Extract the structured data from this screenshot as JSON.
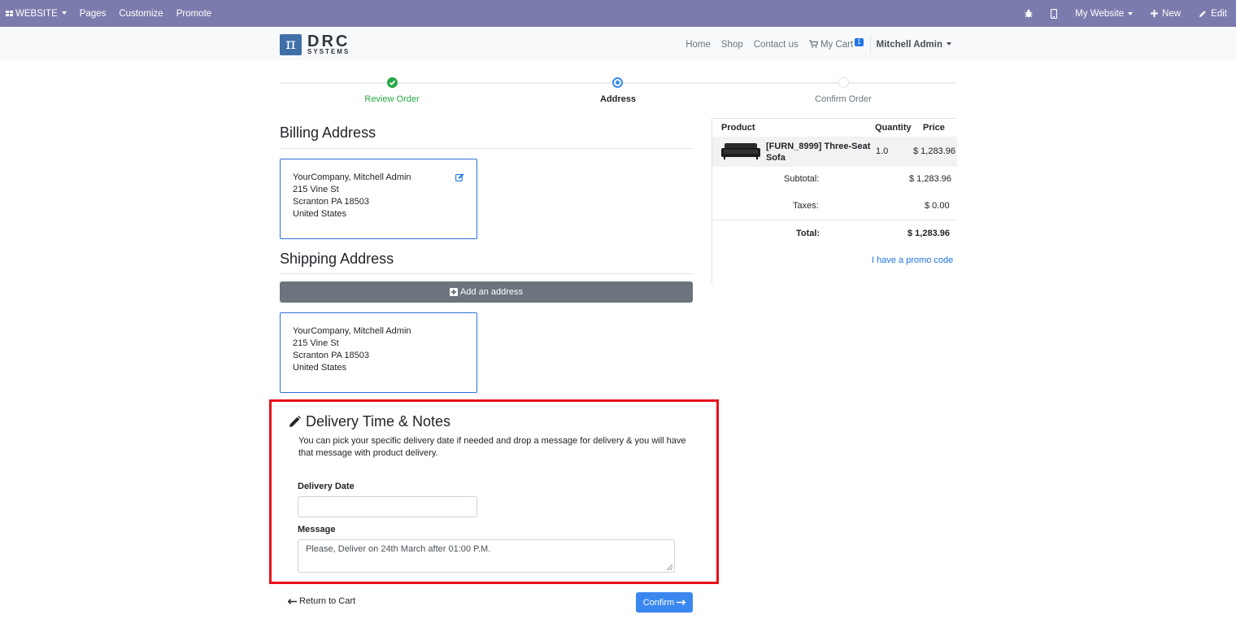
{
  "adminbar": {
    "website_label": "WEBSITE",
    "menu": [
      "Pages",
      "Customize",
      "Promote"
    ],
    "my_website": "My Website",
    "new_label": "New",
    "edit_label": "Edit"
  },
  "brand": {
    "name": "DRC",
    "sub": "SYSTEMS",
    "symbol": "π"
  },
  "nav": {
    "home": "Home",
    "shop": "Shop",
    "contact": "Contact us",
    "cart": "My Cart",
    "cart_count": "1",
    "user": "Mitchell Admin"
  },
  "wizard": {
    "steps": [
      "Review Order",
      "Address",
      "Confirm Order"
    ]
  },
  "billing": {
    "title": "Billing Address",
    "lines": [
      "YourCompany, Mitchell Admin",
      "215 Vine St",
      "Scranton PA 18503",
      "United States"
    ]
  },
  "shipping": {
    "title": "Shipping Address",
    "add_button": "Add an address",
    "lines": [
      "YourCompany, Mitchell Admin",
      "215 Vine St",
      "Scranton PA 18503",
      "United States"
    ]
  },
  "delivery": {
    "title": "Delivery Time & Notes",
    "description": "You can pick your specific delivery date if needed and drop a message for delivery & you will have that message with product delivery.",
    "date_label": "Delivery Date",
    "date_value": "",
    "message_label": "Message",
    "message_value": "Please, Deliver on 24th March after 01:00 P.M."
  },
  "actions": {
    "return": "Return to Cart",
    "confirm": "Confirm"
  },
  "summary": {
    "headers": {
      "product": "Product",
      "quantity": "Quantity",
      "price": "Price"
    },
    "product_name_1": "[FURN_8999] Three-Seat",
    "product_name_2": "Sofa",
    "quantity": "1.0",
    "price": "$ 1,283.96",
    "subtotal_label": "Subtotal:",
    "subtotal": "$ 1,283.96",
    "taxes_label": "Taxes:",
    "taxes": "$ 0.00",
    "total_label": "Total:",
    "total": "$ 1,283.96",
    "promo": "I have a promo code"
  },
  "colors": {
    "admin_bar": "#7c7bad",
    "primary": "#3b87f0",
    "success": "#28a745",
    "highlight": "#e8101a"
  }
}
